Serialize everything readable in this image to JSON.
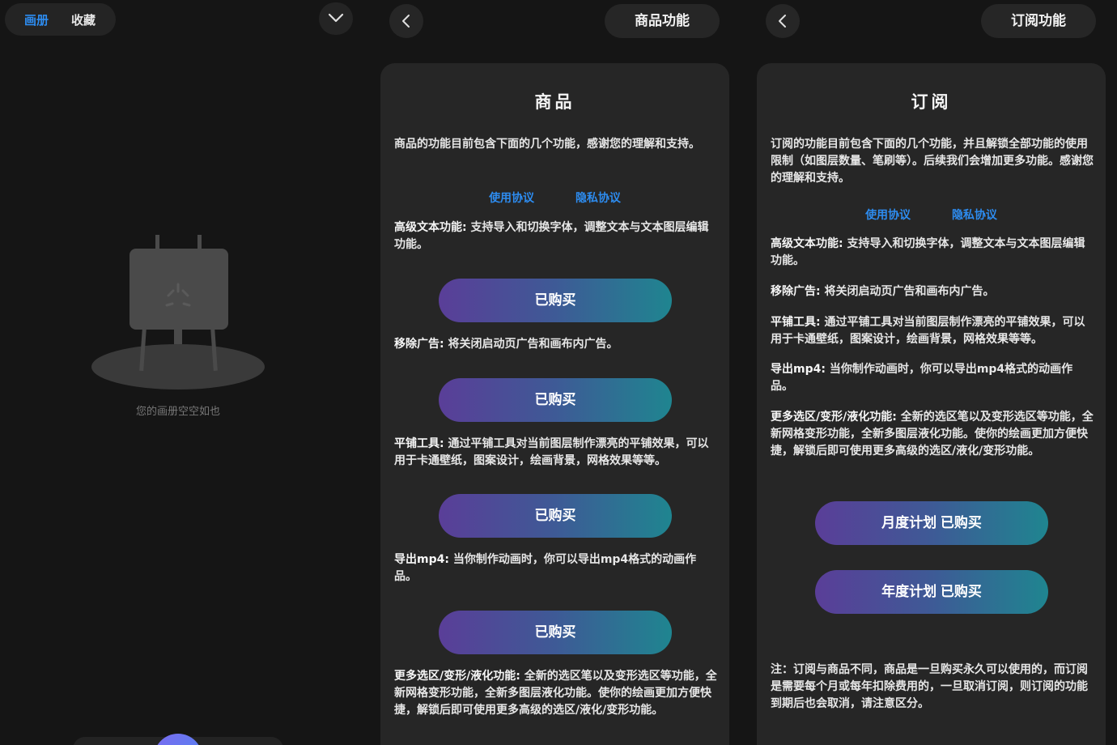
{
  "gallery": {
    "tabs": [
      "画册",
      "收藏"
    ],
    "empty_text": "您的画册空空如也"
  },
  "products": {
    "header_title": "商品功能",
    "card_title": "商品",
    "intro": "商品的功能目前包含下面的几个功能，感谢您的理解和支持。",
    "links": [
      "使用协议",
      "隐私协议"
    ],
    "features": [
      {
        "name": "高级文本功能:",
        "desc": "支持导入和切换字体，调整文本与文本图层编辑功能。",
        "button": "已购买"
      },
      {
        "name": "移除广告:",
        "desc": "将关闭启动页广告和画布内广告。",
        "button": "已购买"
      },
      {
        "name": "平铺工具:",
        "desc": "通过平铺工具对当前图层制作漂亮的平铺效果，可以用于卡通壁纸，图案设计，绘画背景，网格效果等等。",
        "button": "已购买"
      },
      {
        "name": "导出mp4:",
        "desc": "当你制作动画时，你可以导出mp4格式的动画作品。",
        "button": "已购买"
      },
      {
        "name": "更多选区/变形/液化功能:",
        "desc": "全新的选区笔以及变形选区等功能，全新网格变形功能，全新多图层液化功能。使你的绘画更加方便快捷，解锁后即可使用更多高级的选区/液化/变形功能。"
      }
    ]
  },
  "subscriptions": {
    "header_title": "订阅功能",
    "card_title": "订阅",
    "intro": "订阅的功能目前包含下面的几个功能，并且解锁全部功能的使用限制（如图层数量、笔刷等）。后续我们会增加更多功能。感谢您的理解和支持。",
    "links": [
      "使用协议",
      "隐私协议"
    ],
    "features": [
      {
        "name": "高级文本功能:",
        "desc": "支持导入和切换字体，调整文本与文本图层编辑功能。"
      },
      {
        "name": "移除广告:",
        "desc": "将关闭启动页广告和画布内广告。"
      },
      {
        "name": "平铺工具:",
        "desc": "通过平铺工具对当前图层制作漂亮的平铺效果，可以用于卡通壁纸，图案设计，绘画背景，网格效果等等。"
      },
      {
        "name": "导出mp4:",
        "desc": "当你制作动画时，你可以导出mp4格式的动画作品。"
      },
      {
        "name": "更多选区/变形/液化功能:",
        "desc": "全新的选区笔以及变形选区等功能，全新网格变形功能，全新多图层液化功能。使你的绘画更加方便快捷，解锁后即可使用更多高级的选区/液化/变形功能。"
      }
    ],
    "plans": [
      "月度计划 已购买",
      "年度计划 已购买"
    ],
    "note": "注：订阅与商品不同，商品是一旦购买永久可以使用的，而订阅是需要每个月或每年扣除费用的，一旦取消订阅，则订阅的功能到期后也会取消，请注意区分。"
  },
  "colors": {
    "background": "#151515",
    "card": "#262626",
    "link_blue": "#2d8cf0",
    "button_gradient": [
      "#5a3e98",
      "#3e5a96",
      "#1f8590"
    ]
  }
}
